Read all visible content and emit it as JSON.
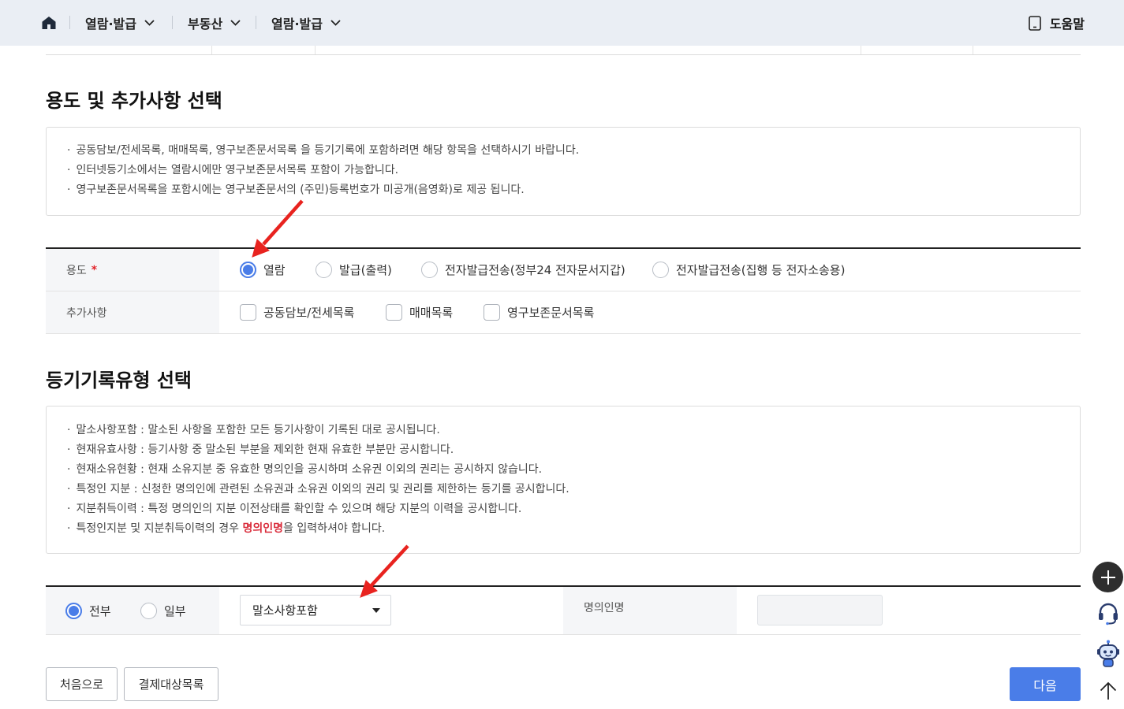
{
  "nav": {
    "home_icon": "home-icon",
    "items": [
      {
        "label": "열람·발급",
        "icon": "chevron-down-icon"
      },
      {
        "label": "부동산",
        "icon": "chevron-down-icon"
      },
      {
        "label": "열람·발급",
        "icon": "chevron-down-icon"
      }
    ],
    "help": {
      "label": "도움말",
      "icon": "document-icon"
    }
  },
  "purpose_section": {
    "title": "용도 및 추가사항 선택",
    "notices": [
      "공동담보/전세목록, 매매목록, 영구보존문서목록 을 등기기록에 포함하려면 해당 항목을 선택하시기 바랍니다.",
      "인터넷등기소에서는 열람시에만 영구보존문서목록 포함이 가능합니다.",
      "영구보존문서목록을 포함시에는 영구보존문서의 (주민)등록번호가 미공개(음영화)로 제공 됩니다."
    ],
    "purpose": {
      "label": "용도",
      "required_mark": "*",
      "options": [
        {
          "label": "열람",
          "checked": true
        },
        {
          "label": "발급(출력)",
          "checked": false
        },
        {
          "label": "전자발급전송(정부24 전자문서지갑)",
          "checked": false
        },
        {
          "label": "전자발급전송(집행 등 전자소송용)",
          "checked": false
        }
      ]
    },
    "extras": {
      "label": "추가사항",
      "options": [
        {
          "label": "공동담보/전세목록",
          "checked": false
        },
        {
          "label": "매매목록",
          "checked": false
        },
        {
          "label": "영구보존문서목록",
          "checked": false
        }
      ]
    }
  },
  "record_type_section": {
    "title": "등기기록유형 선택",
    "notices": [
      "말소사항포함 : 말소된 사항을 포함한 모든 등기사항이 기록된 대로 공시됩니다.",
      "현재유효사항 : 등기사항 중 말소된 부분을 제외한 현재 유효한 부분만 공시합니다.",
      "현재소유현황 : 현재 소유지분 중 유효한 명의인을 공시하며 소유권 이외의 권리는 공시하지 않습니다.",
      "특정인 지분 : 신청한 명의인에 관련된 소유권과 소유권 이외의 권리 및 권리를 제한하는 등기를 공시합니다.",
      "지분취득이력 : 특정 명의인의 지분 이전상태를 확인할 수 있으며 해당 지분의 이력을 공시합니다."
    ],
    "name_notice": {
      "before": "특정인지분 및 지분취득이력의 경우 ",
      "highlight": "명의인명",
      "after": "을 입력하셔야 합니다."
    },
    "scope": {
      "options": [
        {
          "label": "전부",
          "checked": true
        },
        {
          "label": "일부",
          "checked": false
        }
      ]
    },
    "record_type_select": {
      "selected": "말소사항포함",
      "icon": "caret-down-icon"
    },
    "owner_name": {
      "label": "명의인명",
      "value": ""
    }
  },
  "actions": {
    "first": "처음으로",
    "payment_list": "결제대상목록",
    "next": "다음"
  },
  "floating_tools": [
    {
      "icon": "plus-icon"
    },
    {
      "icon": "headset-icon"
    },
    {
      "icon": "chatbot-icon"
    },
    {
      "icon": "arrow-up-icon"
    }
  ],
  "colors": {
    "nav_bg": "#eaeef4",
    "accent": "#4a7de8",
    "required_mark": "#e2242b",
    "highlight_text": "#d92b3a",
    "annotation_arrow": "#e8231f"
  }
}
